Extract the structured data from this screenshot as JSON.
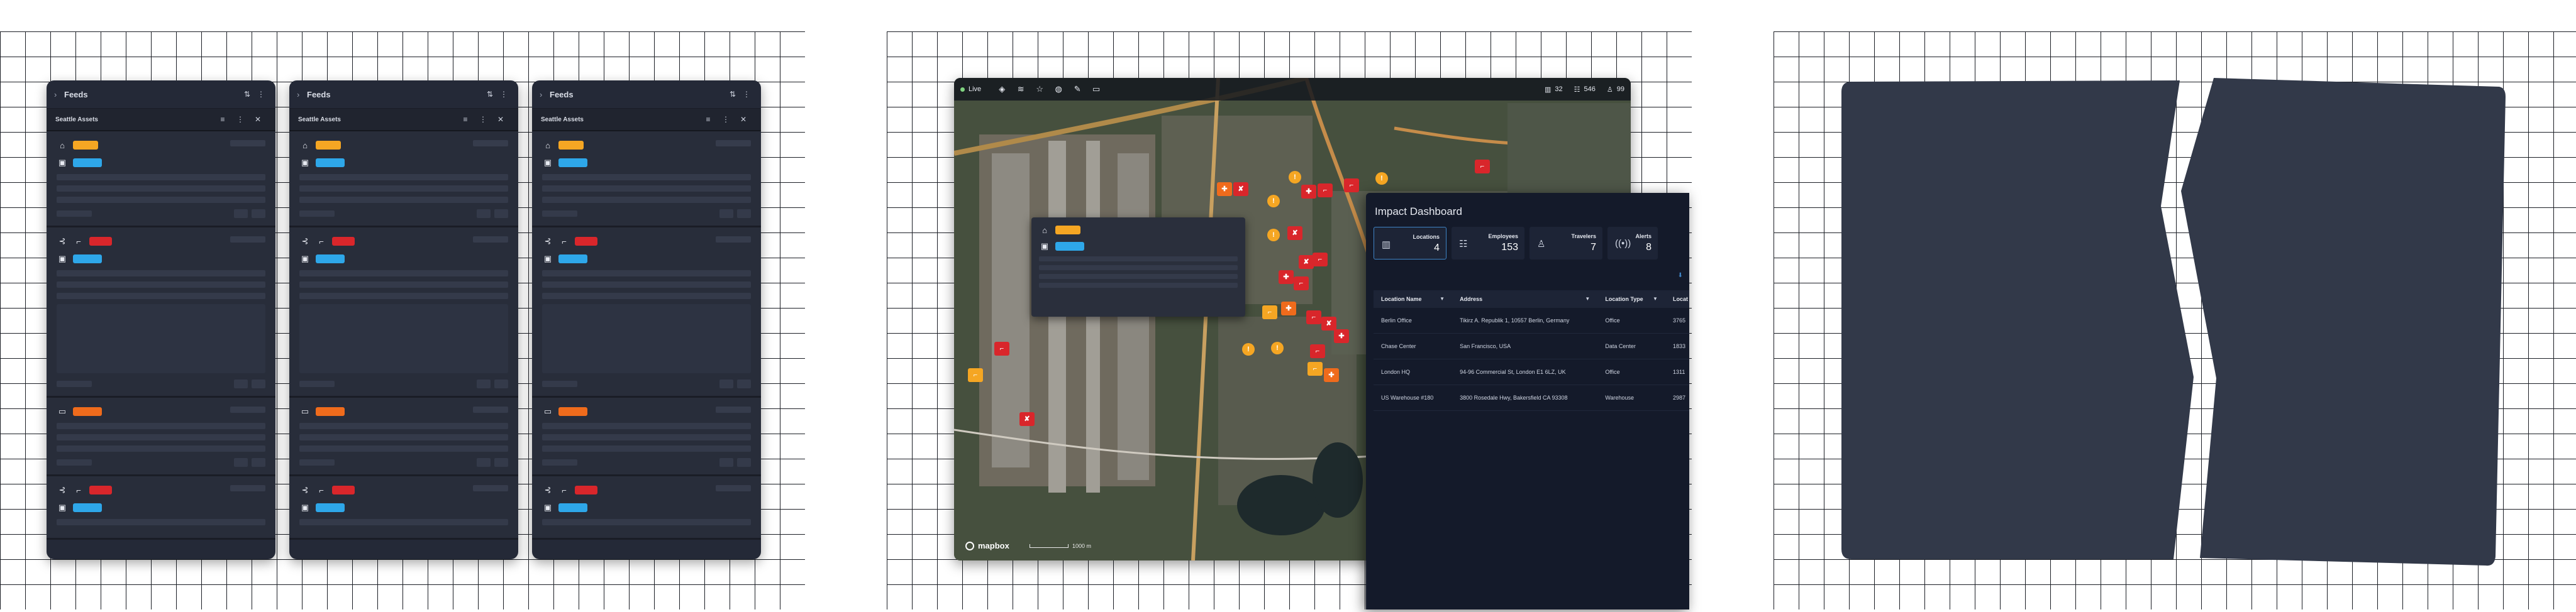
{
  "feeds": [
    {
      "title": "Feeds",
      "list_title": "Seattle Assets"
    },
    {
      "title": "Feeds",
      "list_title": "Seattle Assets"
    },
    {
      "title": "Feeds",
      "list_title": "Seattle Assets"
    }
  ],
  "map": {
    "live_label": "Live",
    "stats": [
      {
        "icon": "building-icon",
        "value": "32"
      },
      {
        "icon": "people-icon",
        "value": "546"
      },
      {
        "icon": "traveler-icon",
        "value": "99"
      }
    ],
    "attribution": "mapbox",
    "scale_label": "1000 m"
  },
  "dashboard": {
    "title": "Impact Dashboard",
    "kpis": [
      {
        "label": "Locations",
        "value": "4",
        "icon": "building-icon"
      },
      {
        "label": "Employees",
        "value": "153",
        "icon": "people-icon"
      },
      {
        "label": "Travelers",
        "value": "7",
        "icon": "traveler-icon"
      },
      {
        "label": "Alerts",
        "value": "8",
        "icon": "broadcast-icon"
      }
    ],
    "columns": [
      "Location Name",
      "Address",
      "Location Type",
      "Locat"
    ],
    "rows": [
      {
        "name": "Berlin Office",
        "address": "Tikirz A. Republik 1, 10557 Berlin, Germany",
        "type": "Office",
        "extra": "3765"
      },
      {
        "name": "Chase Center",
        "address": "San Francisco, USA",
        "type": "Data Center",
        "extra": "1833"
      },
      {
        "name": "London HQ",
        "address": "94-96 Commercial St, London E1 6LZ, UK",
        "type": "Office",
        "extra": "1311"
      },
      {
        "name": "US Warehouse #180",
        "address": "3800 Rosedale Hwy, Bakersfield CA 93308",
        "type": "Warehouse",
        "extra": "2987"
      }
    ]
  },
  "colors": {
    "yellow": "#f5a623",
    "blue": "#2ea7e9",
    "red": "#d9262b",
    "orange": "#ef6b1c",
    "panel": "#242937",
    "dash": "#141a2a",
    "blank": "#323949"
  }
}
